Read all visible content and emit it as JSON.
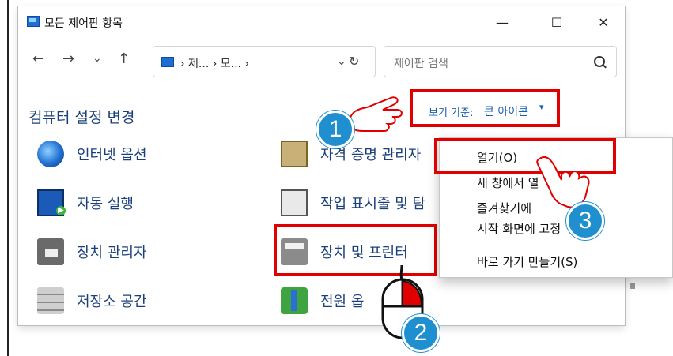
{
  "window": {
    "title": "모든 제어판 항목",
    "controls": {
      "minimize": "—",
      "maximize": "☐",
      "close": "✕"
    }
  },
  "nav": {
    "back": "←",
    "forward": "→",
    "recent": "⌄",
    "up": "↑",
    "breadcrumb": "› 제... › 모... ›",
    "dropdown": "⌄",
    "refresh": "↻",
    "search_placeholder": "제어판 검색"
  },
  "header": {
    "title": "컴퓨터 설정 변경",
    "view_by_label": "보기 기준:",
    "view_by_value": "큰 아이콘",
    "view_by_caret": "▾"
  },
  "items": {
    "left": [
      {
        "label": "인터넷 옵션",
        "icon": "globe-icon"
      },
      {
        "label": "자동 실행",
        "icon": "autoplay-icon"
      },
      {
        "label": "장치 관리자",
        "icon": "device-manager-icon"
      },
      {
        "label": "저장소 공간",
        "icon": "storage-spaces-icon"
      }
    ],
    "right": [
      {
        "label": "자격 증명 관리자",
        "icon": "credential-manager-icon"
      },
      {
        "label": "작업 표시줄 및 탐",
        "icon": "taskbar-icon"
      },
      {
        "label": "장치 및 프린터",
        "icon": "printer-icon"
      },
      {
        "label": "전원 옵",
        "icon": "power-options-icon"
      }
    ]
  },
  "context_menu": {
    "items": [
      {
        "label": "열기(O)"
      },
      {
        "label": "새 창에서 열"
      },
      {
        "label": "즐겨찾기에"
      },
      {
        "label": "시작 화면에 고정"
      }
    ],
    "after_separator": {
      "label": "바로 가기 만들기(S)"
    }
  },
  "badges": {
    "step1": "1",
    "step2": "2",
    "step3": "3"
  },
  "colors": {
    "highlight_red": "#e00000",
    "link_blue": "#1a5fb4",
    "badge_blue": "#1f8fcf"
  }
}
